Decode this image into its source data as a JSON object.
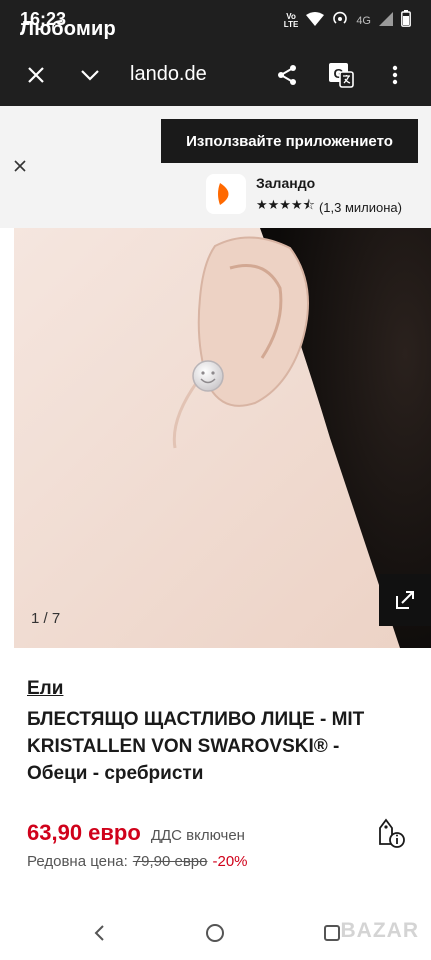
{
  "status": {
    "time": "16:23",
    "owner": "Любомир",
    "volte": [
      "Vo",
      "LTE"
    ],
    "network": "4G"
  },
  "toolbar": {
    "url": "lando.de"
  },
  "banner": {
    "use_app_label": "Използвайте приложението",
    "app_name": "Заландо",
    "stars": "★★★★⯪",
    "rating_count": "(1,3 милиона)",
    "brand_color": "#ff6900"
  },
  "gallery": {
    "counter": "1 / 7"
  },
  "product": {
    "brand": "Ели",
    "title": "БЛЕСТЯЩО ЩАСТЛИВО ЛИЦЕ - MIT KRISTALLEN VON SWAROVSKI® - Обеци - сребристи",
    "price": "63,90 евро",
    "vat": "ДДС включен",
    "regular_label": "Редовна цена:",
    "old_price": "79,90 евро",
    "discount": "-20%",
    "sale_color": "#d0021b"
  },
  "watermark": "BAZAR"
}
